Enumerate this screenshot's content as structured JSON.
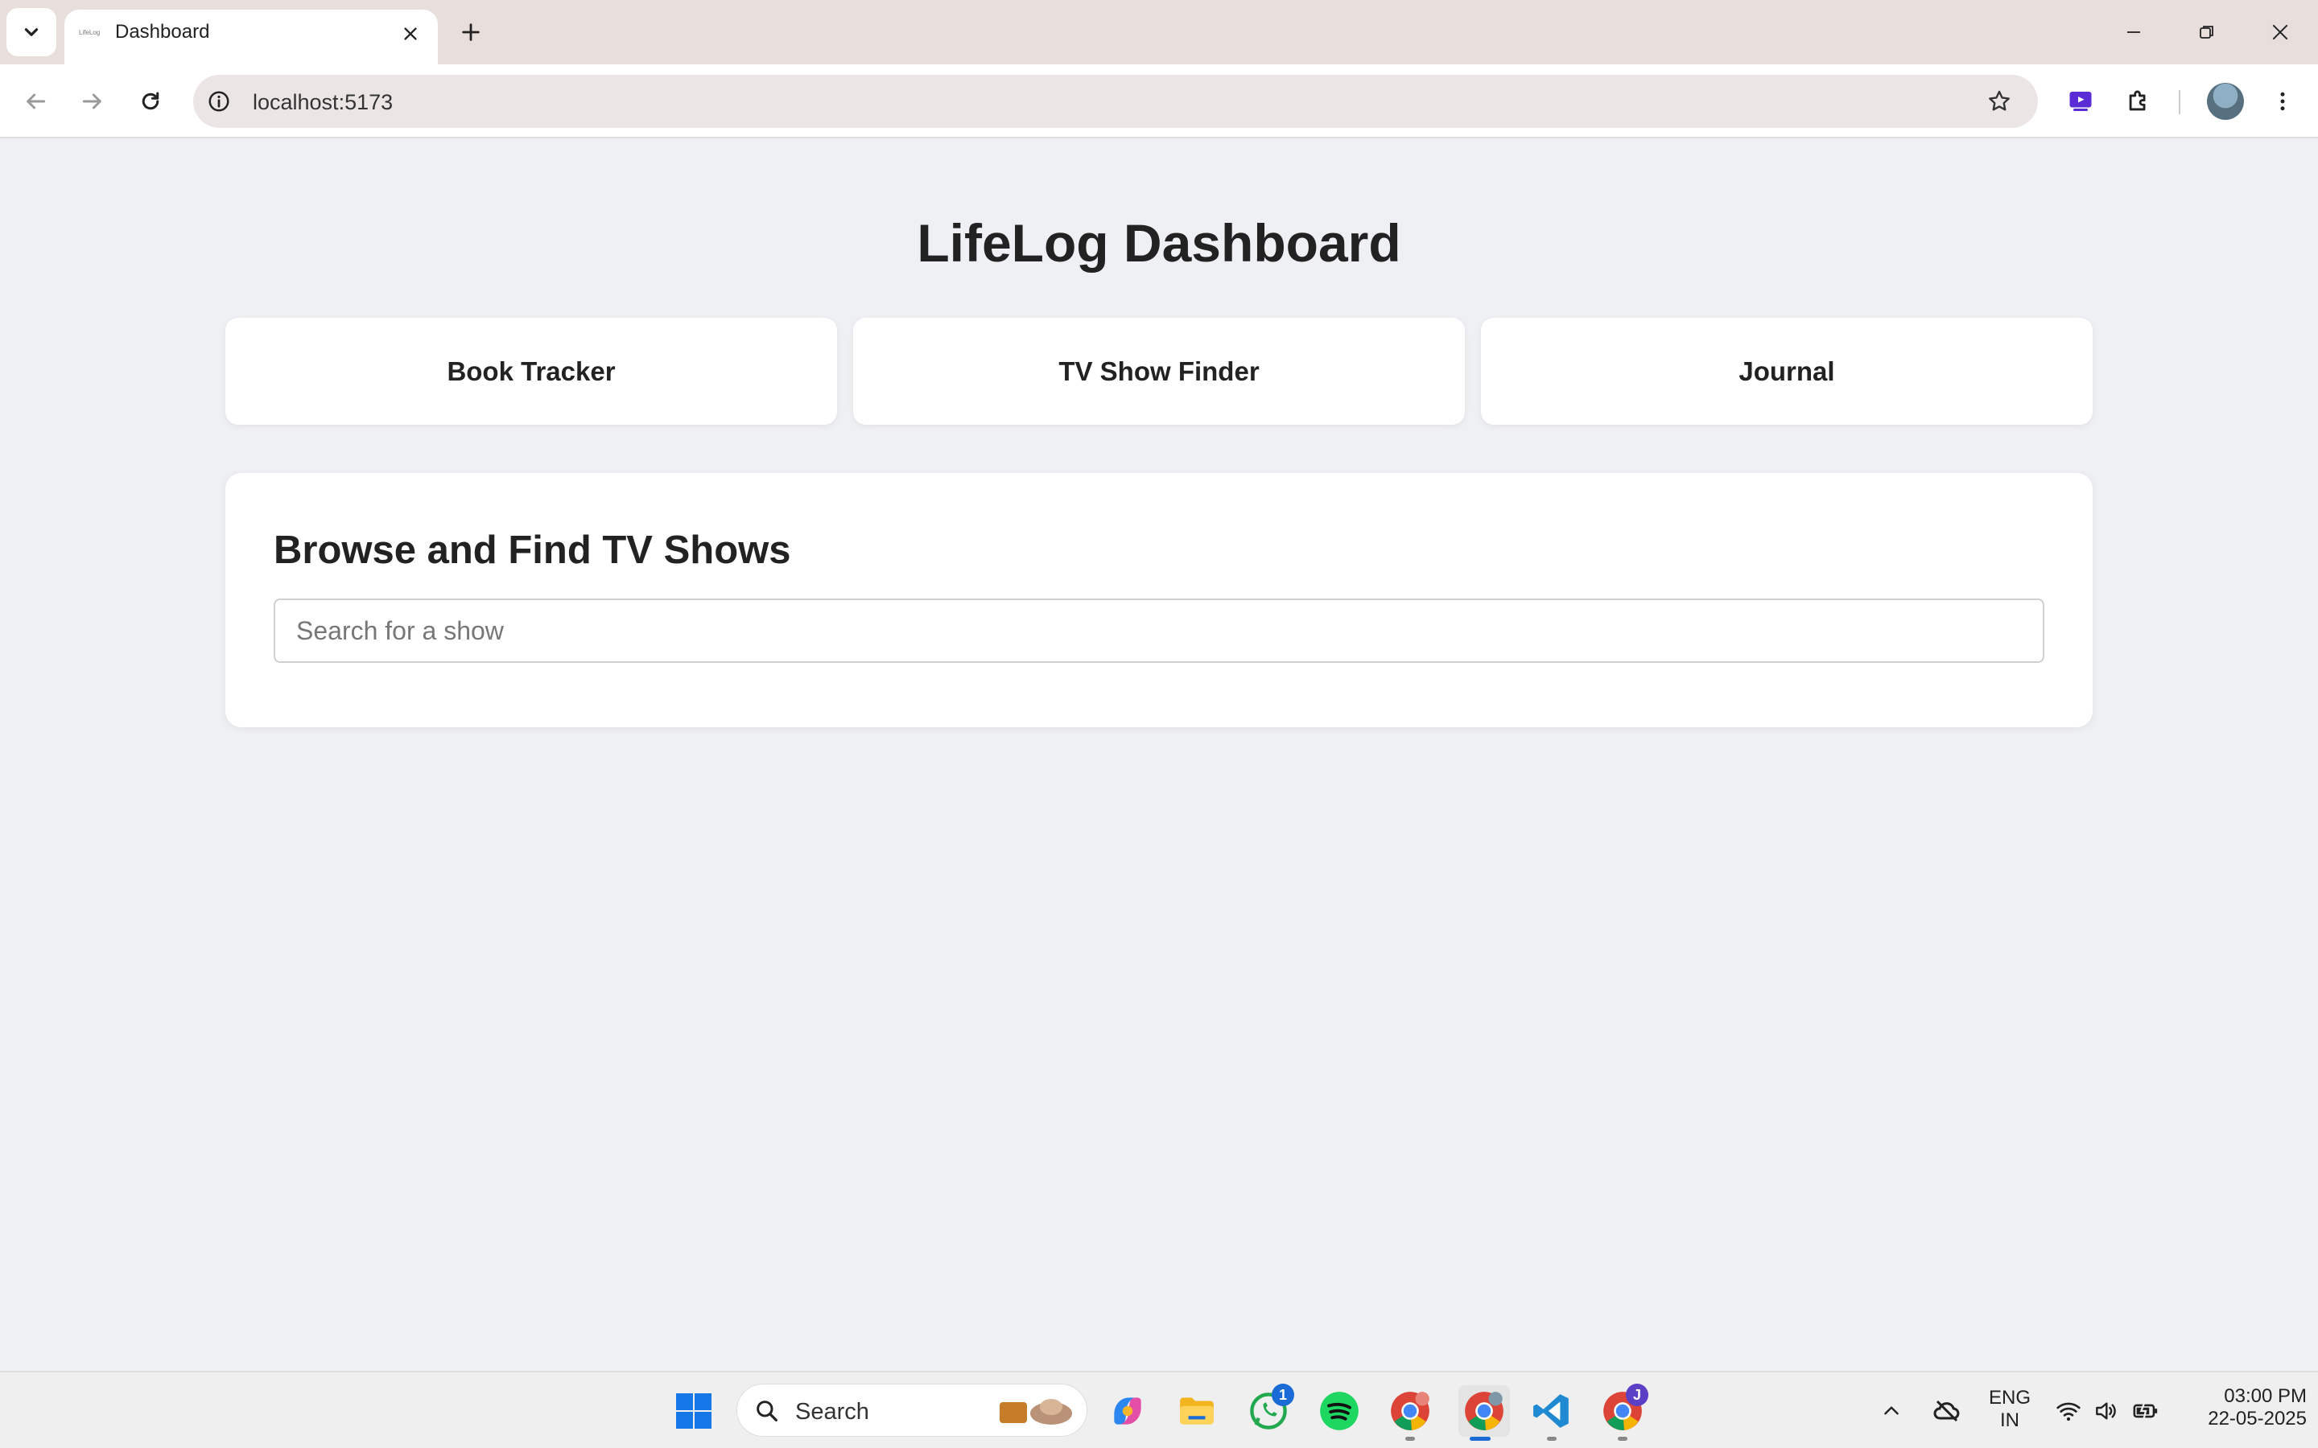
{
  "browser": {
    "tab_title": "Dashboard",
    "favicon_text": "LifeLog",
    "url": "localhost:5173"
  },
  "page": {
    "title": "LifeLog Dashboard",
    "nav_cards": [
      {
        "label": "Book Tracker"
      },
      {
        "label": "TV Show Finder"
      },
      {
        "label": "Journal"
      }
    ],
    "section_title": "Browse and Find TV Shows",
    "search_placeholder": "Search for a show",
    "search_value": ""
  },
  "taskbar": {
    "search_label": "Search",
    "whatsapp_badge": "1",
    "chrome_profile_badge": "J",
    "language_line1": "ENG",
    "language_line2": "IN",
    "time": "03:00 PM",
    "date": "22-05-2025"
  },
  "colors": {
    "page_background": "#eff0f3",
    "card_background": "#ffffff",
    "tabbar_background": "#e8dedc",
    "accent_blue": "#1a6bd6"
  }
}
